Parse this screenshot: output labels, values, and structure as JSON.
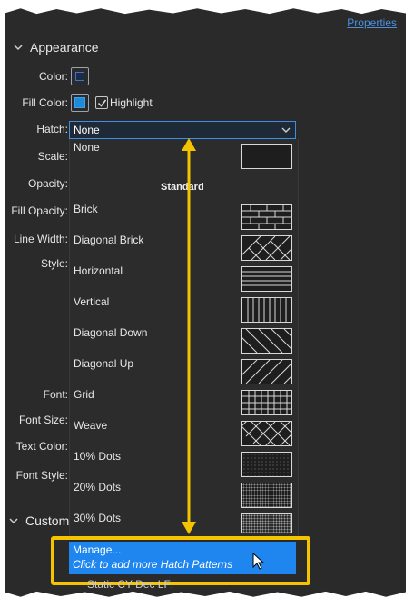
{
  "top_link": "Properties",
  "appearance": {
    "title": "Appearance",
    "labels": {
      "color": "Color:",
      "fill_color": "Fill Color:",
      "hatch": "Hatch:",
      "scale": "Scale:",
      "opacity": "Opacity:",
      "fill_opacity": "Fill Opacity:",
      "line_width": "Line Width:",
      "style": "Style:",
      "font": "Font:",
      "font_size": "Font Size:",
      "text_color": "Text Color:",
      "font_style": "Font Style:"
    },
    "highlight_label": "Highlight",
    "highlight_checked": true,
    "color_value": "#1b2c48",
    "fill_color_value": "#1f8ad8"
  },
  "hatch_dropdown": {
    "selected": "None",
    "options": [
      {
        "label": "None",
        "pattern": "none"
      },
      {
        "label": "Brick",
        "pattern": "brick"
      },
      {
        "label": "Diagonal Brick",
        "pattern": "diagonal-brick"
      },
      {
        "label": "Horizontal",
        "pattern": "horizontal"
      },
      {
        "label": "Vertical",
        "pattern": "vertical"
      },
      {
        "label": "Diagonal Down",
        "pattern": "diagonal-down"
      },
      {
        "label": "Diagonal Up",
        "pattern": "diagonal-up"
      },
      {
        "label": "Grid",
        "pattern": "grid"
      },
      {
        "label": "Weave",
        "pattern": "weave"
      },
      {
        "label": "10% Dots",
        "pattern": "dots-10"
      },
      {
        "label": "20% Dots",
        "pattern": "dots-20"
      },
      {
        "label": "30% Dots",
        "pattern": "dots-30"
      }
    ],
    "group_header": "Standard",
    "manage_label": "Manage...",
    "manage_hint": "Click to add more Hatch Patterns"
  },
  "custom_section": "Custom",
  "cut_text": "Static CY Dec LF:",
  "colors": {
    "accent": "#1f86f0",
    "highlight_box": "#f5c400",
    "panel_bg": "#2a2a2a"
  }
}
